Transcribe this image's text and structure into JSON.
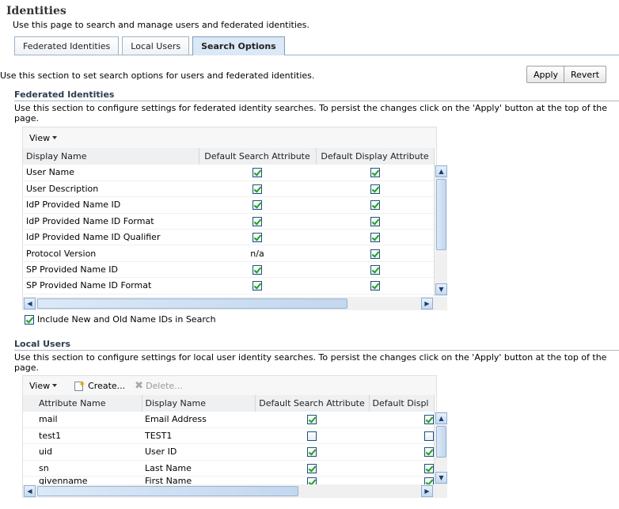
{
  "page": {
    "title": "Identities",
    "description": "Use this page to search and manage users and federated identities."
  },
  "tabs": [
    {
      "label": "Federated Identities",
      "active": false
    },
    {
      "label": "Local Users",
      "active": false
    },
    {
      "label": "Search Options",
      "active": true
    }
  ],
  "search_options": {
    "description": "Use this section to set search options for users and federated identities.",
    "apply_label": "Apply",
    "revert_label": "Revert"
  },
  "federated": {
    "title": "Federated Identities",
    "description_line1": "Use this section to configure settings for federated identity searches. To persist the changes click on the 'Apply' button at the top of the",
    "description_line2": "page.",
    "view_label": "View",
    "columns": [
      "Display Name",
      "Default Search Attribute",
      "Default Display Attribute"
    ],
    "rows": [
      {
        "name": "User Name",
        "search": true,
        "display": true
      },
      {
        "name": "User Description",
        "search": true,
        "display": true
      },
      {
        "name": "IdP Provided Name ID",
        "search": true,
        "display": true
      },
      {
        "name": "IdP Provided Name ID Format",
        "search": true,
        "display": true
      },
      {
        "name": "IdP Provided Name ID Qualifier",
        "search": true,
        "display": true
      },
      {
        "name": "Protocol Version",
        "search_text": "n/a",
        "display": true
      },
      {
        "name": "SP Provided Name ID",
        "search": true,
        "display": true
      },
      {
        "name": "SP Provided Name ID Format",
        "search": true,
        "display": true
      }
    ],
    "include_label": "Include New and Old Name IDs in Search",
    "include_checked": true
  },
  "local": {
    "title": "Local Users",
    "description_line1": "Use this section to configure settings for local user identity searches. To persist the changes click on the 'Apply' button at the top of the",
    "description_line2": "page.",
    "view_label": "View",
    "create_label": "Create...",
    "delete_label": "Delete...",
    "columns": [
      "Attribute Name",
      "Display Name",
      "Default Search Attribute",
      "Default Displ"
    ],
    "rows": [
      {
        "attr": "mail",
        "display_name": "Email Address",
        "search": true,
        "display": true
      },
      {
        "attr": "test1",
        "display_name": "TEST1",
        "search": false,
        "display": false
      },
      {
        "attr": "uid",
        "display_name": "User ID",
        "search": true,
        "display": true
      },
      {
        "attr": "sn",
        "display_name": "Last Name",
        "search": true,
        "display": true
      },
      {
        "attr": "givenname",
        "display_name": "First Name",
        "search": true,
        "display": true
      }
    ]
  },
  "icons": {
    "create": "create-icon",
    "delete": "delete-icon",
    "view_caret": "chevron-down-icon"
  }
}
